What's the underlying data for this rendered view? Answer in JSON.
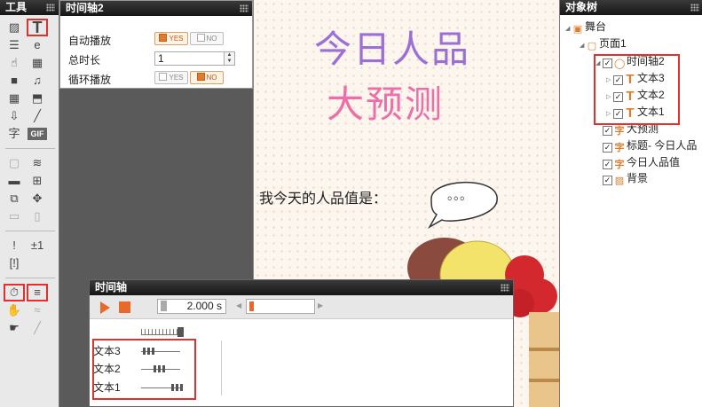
{
  "toolbox": {
    "title": "工具",
    "groups": [
      [
        "image-icon",
        "text-icon",
        "form-icon",
        "link-icon",
        "hand-icon",
        "gallery-icon",
        "video-icon",
        "music-icon",
        "grid-icon",
        "stamp-icon",
        "download-icon",
        "brush-icon",
        "char-icon",
        "gif-icon"
      ],
      [
        "note-icon",
        "layers-icon",
        "folder-icon",
        "crop-icon",
        "window-icon",
        "move-icon",
        "monitor-icon",
        "mobile-icon"
      ],
      [
        "alert-icon",
        "plus-minus-icon",
        "bracket-icon"
      ],
      [
        "timer-icon",
        "timeline-icon",
        "drag-icon",
        "swipe-icon",
        "touch-icon",
        "wand-icon"
      ]
    ],
    "glyphs": {
      "text-icon": "T",
      "char-icon": "字",
      "gif-icon": "GIF",
      "plus-minus-icon": "±1",
      "music-icon": "♫",
      "brush-icon": "╱",
      "timer-icon": "⏱",
      "move-icon": "✥",
      "alert-icon": "!",
      "bracket-icon": "[!]"
    }
  },
  "props": {
    "title": "时间轴2",
    "autoplay_label": "自动播放",
    "duration_label": "总时长",
    "duration_value": "1",
    "loop_label": "循环播放",
    "yes": "YES",
    "no": "NO",
    "autoplay": "YES",
    "loop": "NO"
  },
  "stage": {
    "line1": "今日人品",
    "line2": "大预测",
    "line3": "我今天的人品值是：",
    "bubble": "。。。"
  },
  "tree": {
    "title": "对象树",
    "nodes": [
      {
        "label": "舞台",
        "icon": "stage-icon"
      },
      {
        "label": "页面1",
        "icon": "page-icon"
      },
      {
        "label": "时间轴2",
        "icon": "timeline-icon"
      },
      {
        "label": "文本3",
        "icon": "text-icon"
      },
      {
        "label": "文本2",
        "icon": "text-icon"
      },
      {
        "label": "文本1",
        "icon": "text-icon"
      },
      {
        "label": "大预测",
        "icon": "char-icon"
      },
      {
        "label": "标题- 今日人品",
        "icon": "char-icon"
      },
      {
        "label": "今日人品值",
        "icon": "char-icon"
      },
      {
        "label": "背景",
        "icon": "image-icon"
      }
    ]
  },
  "timeline": {
    "title": "时间轴",
    "time": "2.000 s",
    "tracks": [
      {
        "label": "文本3"
      },
      {
        "label": "文本2"
      },
      {
        "label": "文本1"
      }
    ]
  },
  "colors": {
    "accent": "#e8692a",
    "highlight": "#e03030",
    "purple": "#9b6fd6",
    "pink": "#ee6ea8"
  }
}
